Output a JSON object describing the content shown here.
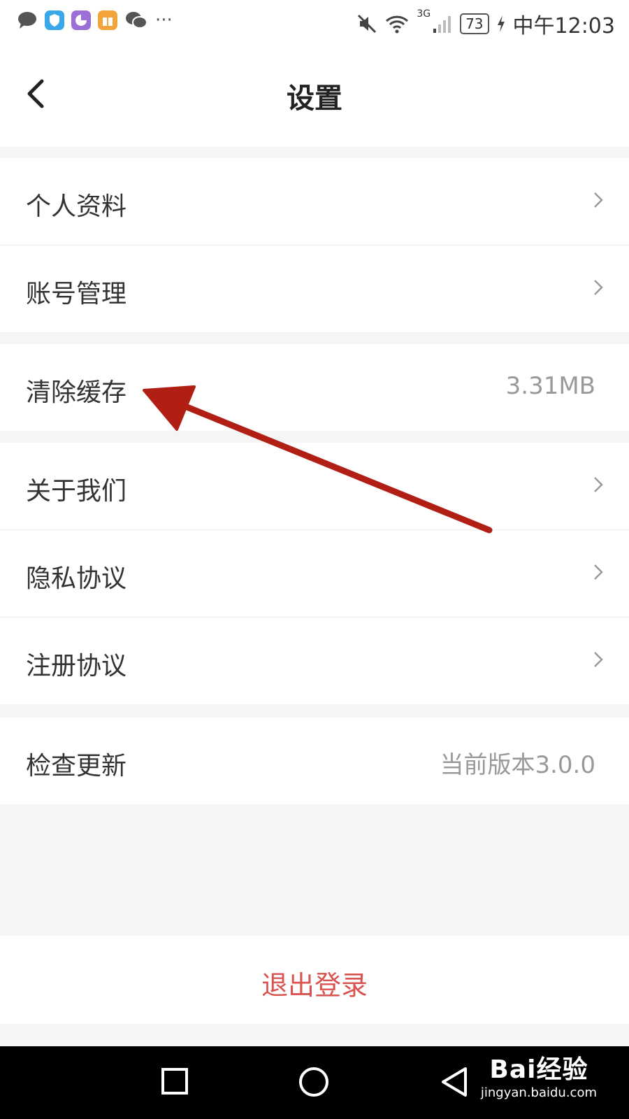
{
  "status_bar": {
    "time": "中午12:03",
    "network": "3G",
    "battery": "73"
  },
  "header": {
    "title": "设置"
  },
  "settings": {
    "group1": [
      {
        "label": "个人资料"
      },
      {
        "label": "账号管理"
      }
    ],
    "group2": [
      {
        "label": "清除缓存",
        "value": "3.31MB"
      }
    ],
    "group3": [
      {
        "label": "关于我们"
      },
      {
        "label": "隐私协议"
      },
      {
        "label": "注册协议"
      }
    ],
    "group4": [
      {
        "label": "检查更新",
        "value": "当前版本3.0.0"
      }
    ]
  },
  "logout": {
    "label": "退出登录"
  },
  "watermark": {
    "main": "Bai经验",
    "sub": "jingyan.baidu.com"
  },
  "colors": {
    "logout_text": "#d9534f",
    "annotation_arrow": "#b01e14"
  },
  "icons": [
    "message-icon",
    "shield-icon",
    "chart-icon",
    "gift-icon",
    "wechat-icon",
    "mute-icon",
    "wifi-icon",
    "signal-icon",
    "charging-icon",
    "back-icon",
    "chevron-right-icon",
    "recent-apps-icon",
    "home-icon",
    "back-nav-icon",
    "annotation-arrow"
  ]
}
